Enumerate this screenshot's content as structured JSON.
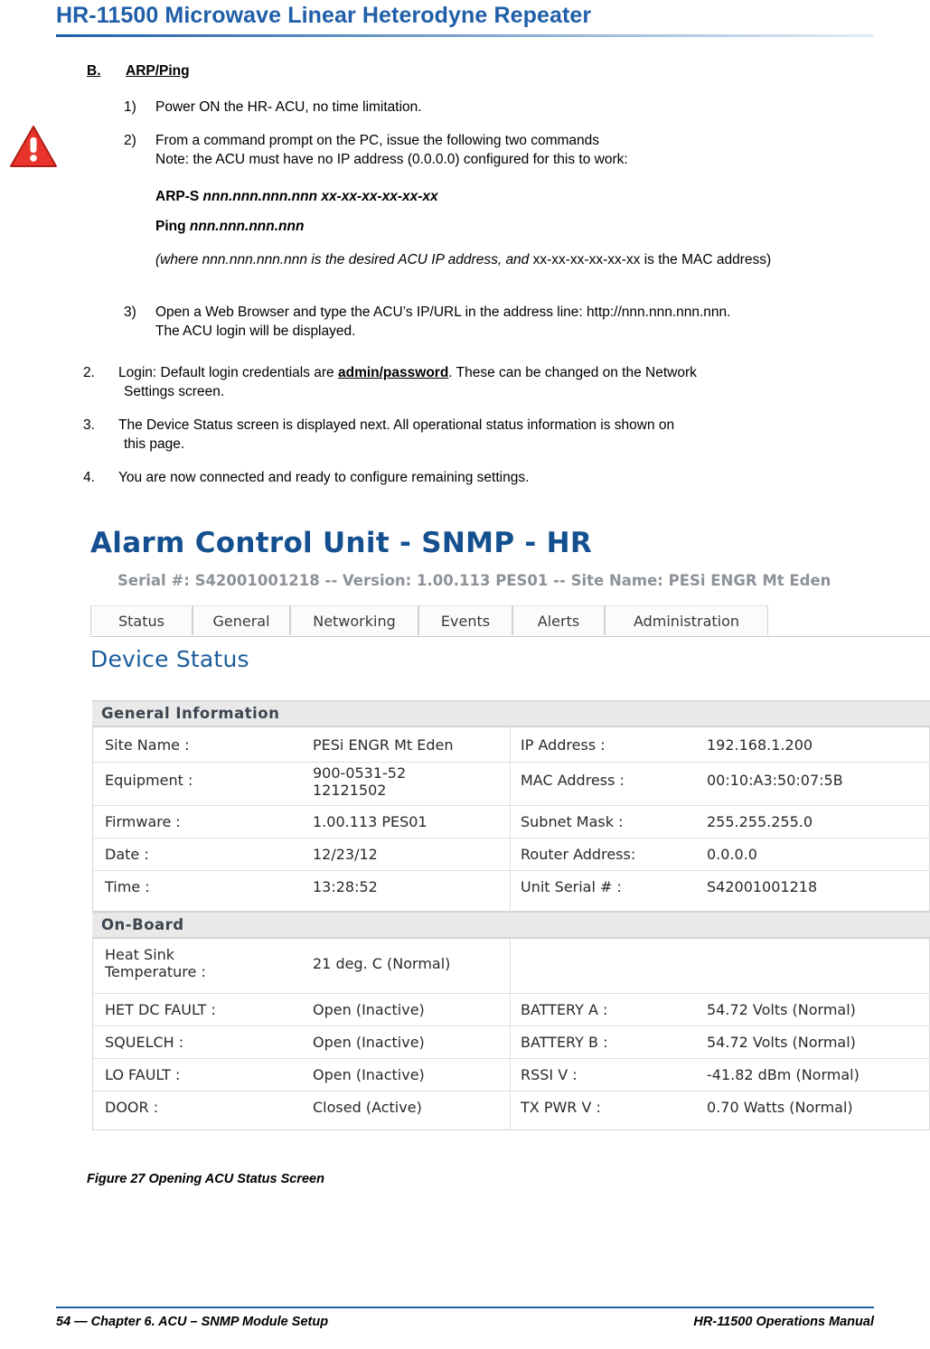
{
  "header": {
    "title": "HR-11500 Microwave Linear Heterodyne Repeater"
  },
  "icons": {
    "warning": "warning-exclamation-icon"
  },
  "content": {
    "section_b_label": "B.",
    "section_b_title": "ARP/Ping",
    "item_b1_num": "1)",
    "item_b1_text": "Power ON the HR- ACU, no time limitation.",
    "item_b2_num": "2)",
    "item_b2_line1": "From a command prompt on the PC, issue the following two commands",
    "item_b2_line2": "Note: the ACU must have no IP address (0.0.0.0) configured for this to work:",
    "cmd_arp_label": "ARP-S",
    "cmd_arp_args": "nnn.nnn.nnn.nnn xx-xx-xx-xx-xx-xx",
    "cmd_ping_label": "Ping",
    "cmd_ping_args": "nnn.nnn.nnn.nnn",
    "where_italic": "(where nnn.nnn.nnn.nnn is the desired ACU IP address, and ",
    "where_plain": "xx-xx-xx-xx-xx-xx is the MAC address)",
    "item_b3_num": "3)",
    "item_b3_line1": "Open a Web Browser and type the ACU’s IP/URL in the address line: http://nnn.nnn.nnn.nnn.",
    "item_b3_line2": "The ACU login will be displayed.",
    "item_2_num": "2.",
    "item_2_pre": "Login: Default login credentials are ",
    "item_2_bold": "admin/password",
    "item_2_post": ". These can be changed on the Network",
    "item_2_line2": "Settings screen.",
    "item_3_num": "3.",
    "item_3_line1": "The Device Status screen is displayed next. All operational status information is shown on",
    "item_3_line2": "this page.",
    "item_4_num": "4.",
    "item_4_text": "You are now connected and ready to configure remaining settings."
  },
  "acu_screen": {
    "title": "Alarm Control Unit - SNMP - HR",
    "subtitle": "Serial #: S42001001218   --   Version: 1.00.113 PES01   --   Site Name:  PESi ENGR Mt Eden",
    "tabs": [
      {
        "label": "Status"
      },
      {
        "label": "General"
      },
      {
        "label": "Networking"
      },
      {
        "label": "Events"
      },
      {
        "label": "Alerts"
      },
      {
        "label": "Administration"
      }
    ],
    "page_heading": "Device Status",
    "general_information": {
      "section_title": "General Information",
      "rows": [
        {
          "label_left": "Site Name :",
          "value_left": "PESi ENGR Mt Eden",
          "label_right": "IP Address :",
          "value_right": "192.168.1.200"
        },
        {
          "label_left": "Equipment :",
          "value_left": "900-0531-52\n12121502",
          "label_right": "MAC Address :",
          "value_right": "00:10:A3:50:07:5B"
        },
        {
          "label_left": "Firmware :",
          "value_left": "1.00.113 PES01",
          "label_right": "Subnet Mask :",
          "value_right": "255.255.255.0"
        },
        {
          "label_left": "Date :",
          "value_left": "12/23/12",
          "label_right": "Router Address:",
          "value_right": "0.0.0.0"
        },
        {
          "label_left": "Time :",
          "value_left": "13:28:52",
          "label_right": "Unit Serial # :",
          "value_right": "S42001001218"
        }
      ]
    },
    "on_board": {
      "section_title": "On-Board",
      "rows": [
        {
          "label_left": "Heat Sink\nTemperature :",
          "value_left": "21 deg. C (Normal)",
          "label_right": "",
          "value_right": ""
        },
        {
          "label_left": "HET DC FAULT :",
          "value_left": "Open (Inactive)",
          "label_right": "BATTERY A :",
          "value_right": "54.72 Volts (Normal)"
        },
        {
          "label_left": "SQUELCH :",
          "value_left": "Open (Inactive)",
          "label_right": "BATTERY B :",
          "value_right": "54.72 Volts (Normal)"
        },
        {
          "label_left": "LO FAULT :",
          "value_left": "Open (Inactive)",
          "label_right": "RSSI V :",
          "value_right": "-41.82 dBm (Normal)"
        },
        {
          "label_left": "DOOR :",
          "value_left": "Closed (Active)",
          "label_right": "TX PWR V :",
          "value_right": "0.70 Watts (Normal)"
        }
      ]
    }
  },
  "figure_caption": "Figure 27  Opening ACU Status Screen",
  "footer": {
    "left": "54   — Chapter 6. ACU – SNMP Module Setup",
    "right": "HR-11500 Operations Manual"
  }
}
